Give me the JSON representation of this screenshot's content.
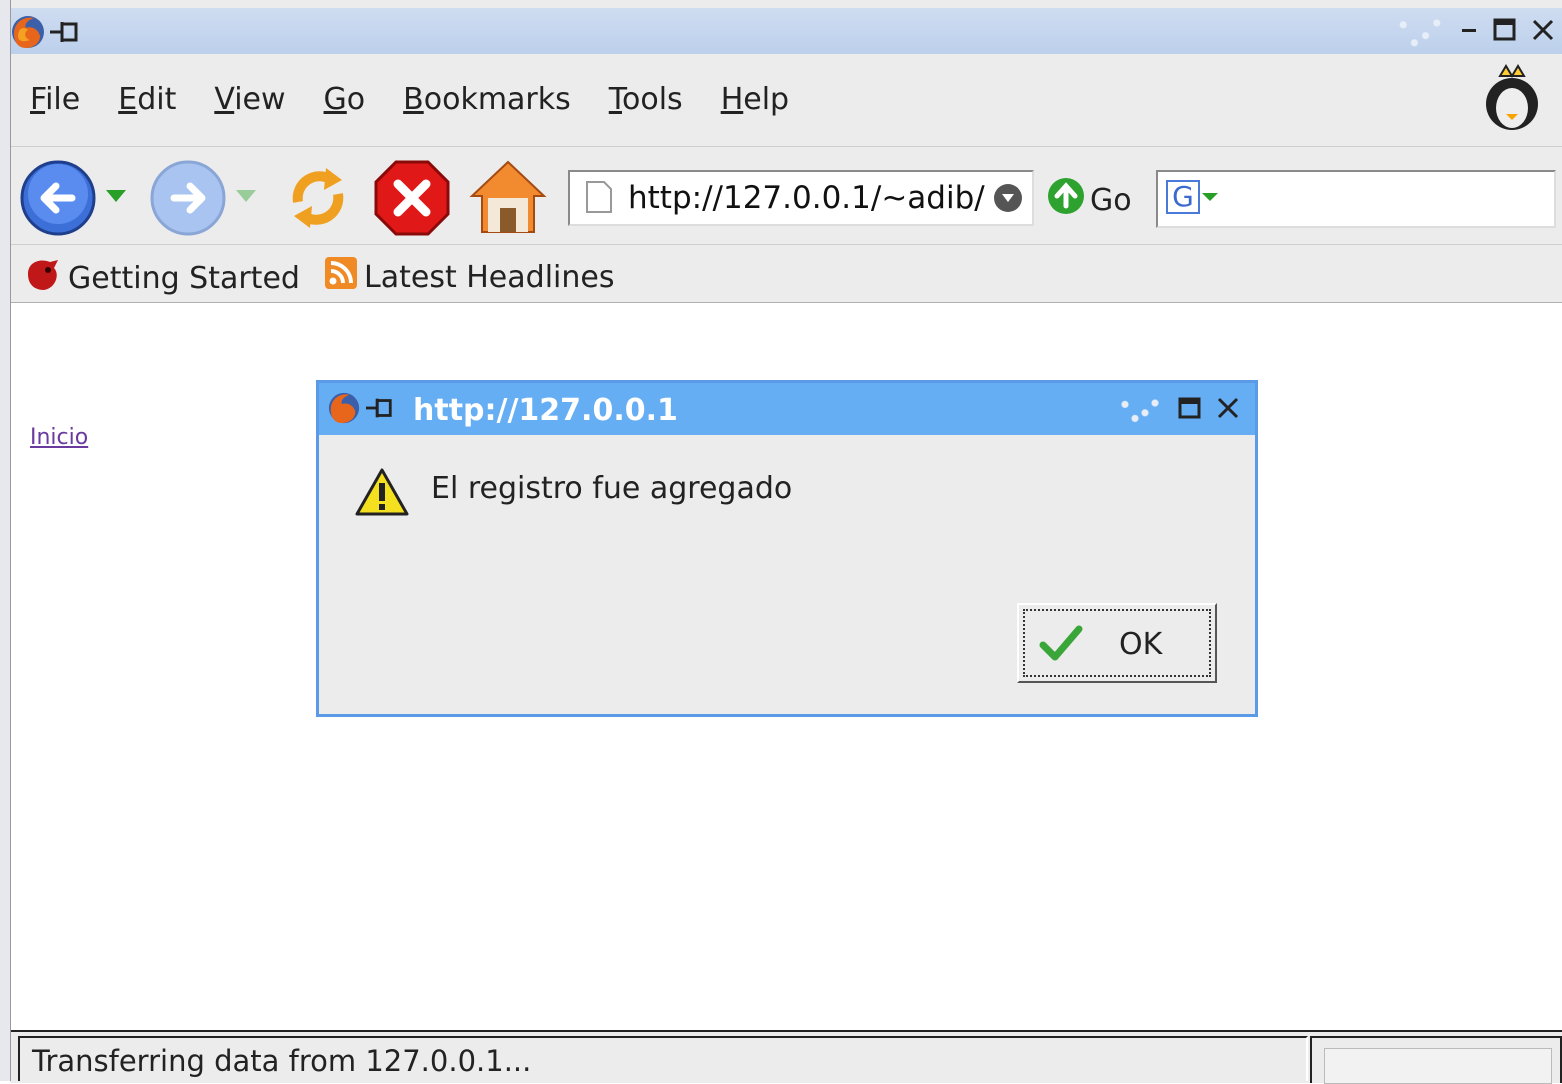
{
  "window": {
    "title": "",
    "controls": {
      "minimize": "minimize-icon",
      "maximize": "maximize-icon",
      "close": "close-icon"
    }
  },
  "menubar": {
    "items": [
      {
        "label": "File",
        "key": "F"
      },
      {
        "label": "Edit",
        "key": "E"
      },
      {
        "label": "View",
        "key": "V"
      },
      {
        "label": "Go",
        "key": "G"
      },
      {
        "label": "Bookmarks",
        "key": "B"
      },
      {
        "label": "Tools",
        "key": "T"
      },
      {
        "label": "Help",
        "key": "H"
      }
    ]
  },
  "toolbar": {
    "url": "http://127.0.0.1/~adib/",
    "go_label": "Go",
    "search_engine": "G",
    "search_value": ""
  },
  "bookmarks": {
    "items": [
      {
        "label": "Getting Started",
        "icon": "firefox-bookmark-icon"
      },
      {
        "label": "Latest Headlines",
        "icon": "rss-feed-icon"
      }
    ]
  },
  "content": {
    "link_label": "Inicio"
  },
  "dialog": {
    "title": "http://127.0.0.1",
    "message": "El registro fue agregado",
    "ok_label": "OK"
  },
  "status": {
    "text": "Transferring data from 127.0.0.1..."
  },
  "colors": {
    "dialog_title": "#66aef4",
    "link": "#6a3a9e",
    "titlebar": "#c5d6ee"
  }
}
